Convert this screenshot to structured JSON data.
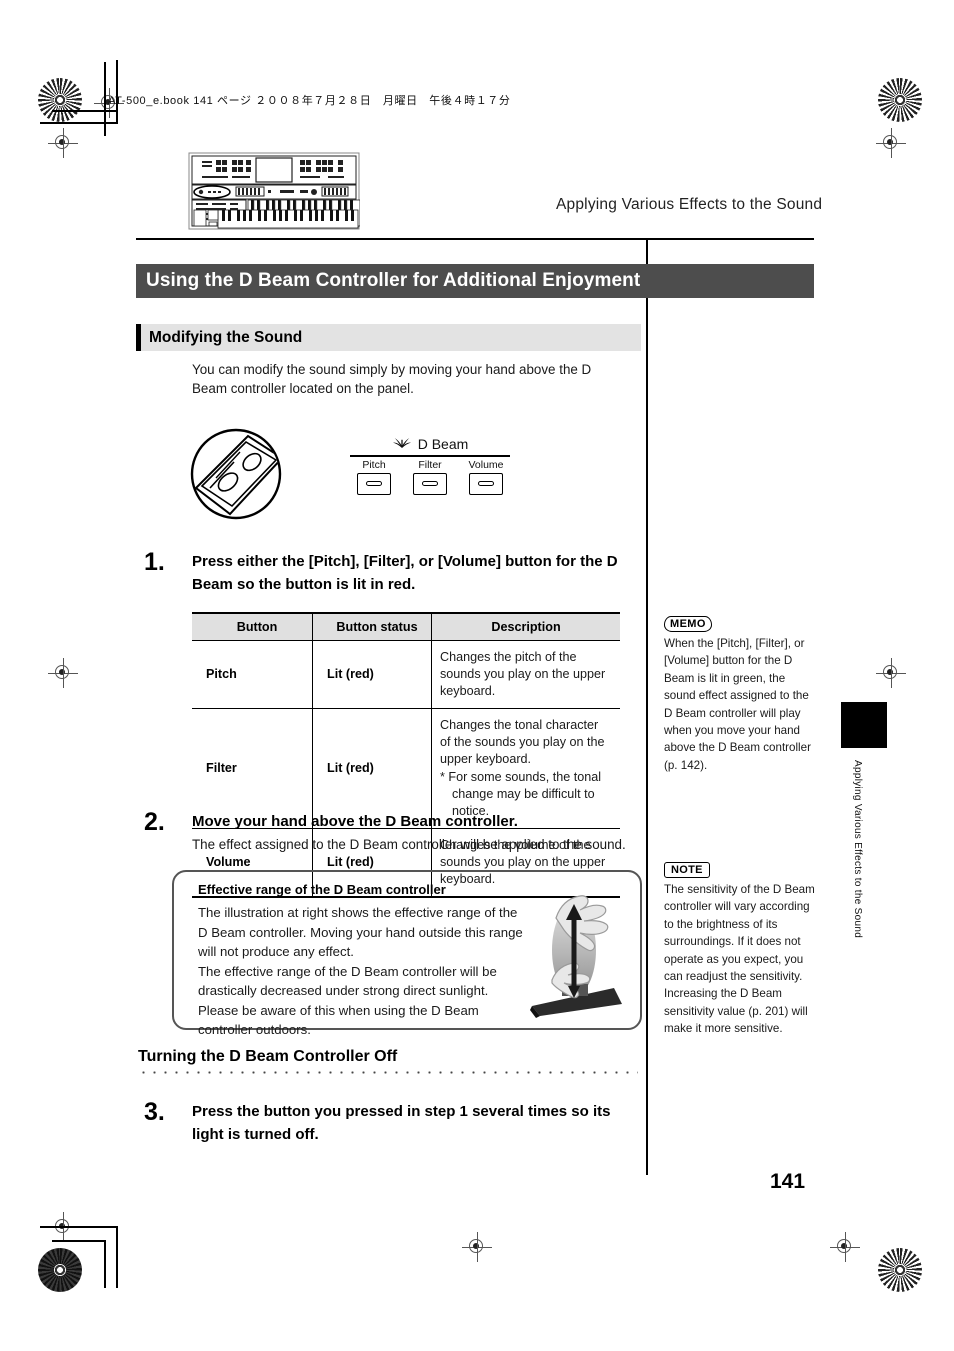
{
  "print": {
    "book_header": "AT-500_e.book  141 ページ  ２００８年７月２８日　月曜日　午後４時１７分"
  },
  "running_head": "Applying Various Effects to the Sound",
  "title_bar": {
    "text": "Using the D Beam Controller for Additional Enjoyment"
  },
  "section": {
    "heading": "Modifying the Sound",
    "intro": "You can modify the sound simply by moving your hand above the D Beam controller located on the panel."
  },
  "dbeam_figure": {
    "logo_label": "D Beam",
    "buttons": [
      {
        "label": "Pitch"
      },
      {
        "label": "Filter"
      },
      {
        "label": "Volume"
      }
    ]
  },
  "steps": [
    {
      "number": "1.",
      "title": "Press either the [Pitch], [Filter], or [Volume] button for the D Beam so the button is lit in red.",
      "sub": ""
    },
    {
      "number": "2.",
      "title": "Move your hand above the D Beam controller.",
      "sub": "The effect assigned to the D Beam controller will be applied to the sound."
    },
    {
      "number": "3.",
      "title": "Press the button you pressed in step 1 several times so its light is turned off.",
      "sub": ""
    }
  ],
  "table": {
    "headers": [
      "Button",
      "Button status",
      "Description"
    ],
    "rows": [
      {
        "button": "Pitch",
        "status": "Lit (red)",
        "description": "Changes the pitch of the sounds you play on the upper keyboard.",
        "note": ""
      },
      {
        "button": "Filter",
        "status": "Lit (red)",
        "description": "Changes the tonal character of the sounds you play on the upper keyboard.",
        "note": "* For some sounds, the tonal change may be difficult to notice."
      },
      {
        "button": "Volume",
        "status": "Lit (red)",
        "description": "Changes the volume of the sounds you play on the upper keyboard.",
        "note": ""
      }
    ]
  },
  "range_box": {
    "title": "Effective range of the D Beam controller",
    "text": "The illustration at right shows the effective range of the D Beam controller. Moving your hand outside this range will not produce any effect.\nThe effective range of the D Beam controller will be drastically decreased under strong direct sunlight. Please be aware of this when using the D Beam controller outdoors."
  },
  "sub_heading": "Turning the D Beam Controller Off",
  "sidebar": {
    "memo": {
      "badge": "MEMO",
      "text": "When the [Pitch], [Filter], or [Volume] button for the D Beam is lit in green, the sound effect assigned to the D Beam controller will play when you move your hand above the D Beam controller (p. 142)."
    },
    "note": {
      "badge": "NOTE",
      "text": "The sensitivity of the D Beam controller will vary according to the brightness of its surroundings. If it does not operate as you expect, you can readjust the sensitivity. Increasing the D Beam sensitivity value (p. 201) will make it more sensitive."
    }
  },
  "edge_tab_label": "Applying Various Effects to the Sound",
  "page_number": "141",
  "colors": {
    "title_bar_bg": "#4d4d4d",
    "section_band_bg": "#e3e3e3",
    "table_header_bg": "#e0e0e0"
  }
}
